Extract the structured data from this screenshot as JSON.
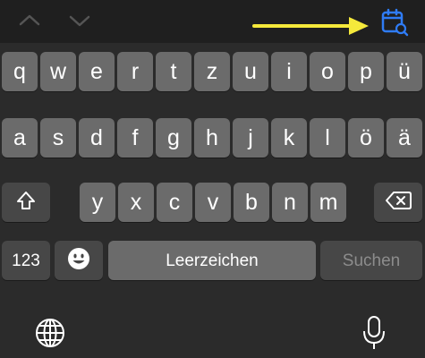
{
  "toolbar": {
    "previous_icon": "chevron-up-icon",
    "next_icon": "chevron-down-icon",
    "arrow_color": "#f5e93b",
    "calendar_icon": "calendar-search-icon",
    "icon_color": "#2f7cf6"
  },
  "keyboard": {
    "row1": [
      "q",
      "w",
      "e",
      "r",
      "t",
      "z",
      "u",
      "i",
      "o",
      "p",
      "ü"
    ],
    "row2": [
      "a",
      "s",
      "d",
      "f",
      "g",
      "h",
      "j",
      "k",
      "l",
      "ö",
      "ä"
    ],
    "row3": [
      "y",
      "x",
      "c",
      "v",
      "b",
      "n",
      "m"
    ],
    "shift_icon": "shift-icon",
    "delete_icon": "delete-icon",
    "numbers_label": "123",
    "emoji_icon": "emoji-icon",
    "space_label": "Leerzeichen",
    "search_label": "Suchen",
    "globe_icon": "globe-icon",
    "mic_icon": "microphone-icon"
  }
}
